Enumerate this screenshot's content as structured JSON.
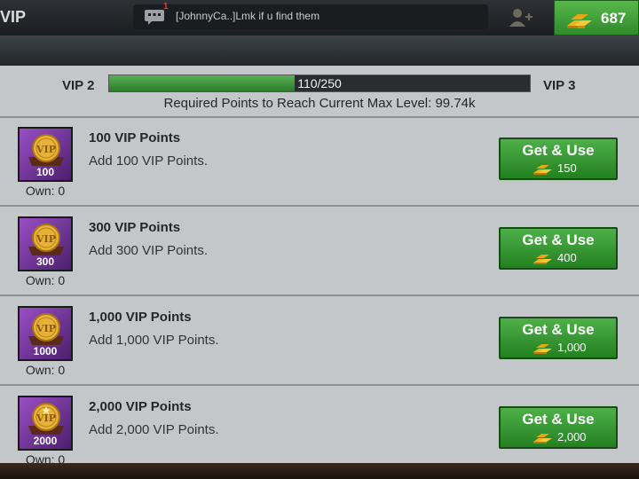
{
  "header": {
    "title": "VIP",
    "chat_badge": "1",
    "chat_message": "[JohnnyCa..]Lmk if u find them",
    "gold": "687"
  },
  "progress": {
    "current_level": "VIP 2",
    "next_level": "VIP 3",
    "text": "110/250",
    "fraction": 0.44,
    "requirement": "Required Points to Reach Current Max Level: 99.74k"
  },
  "items": [
    {
      "icon_number": "100",
      "own": "Own: 0",
      "name": "100 VIP Points",
      "desc": "Add 100 VIP Points.",
      "button_label": "Get & Use",
      "cost": "150"
    },
    {
      "icon_number": "300",
      "own": "Own: 0",
      "name": "300 VIP Points",
      "desc": "Add 300 VIP Points.",
      "button_label": "Get & Use",
      "cost": "400"
    },
    {
      "icon_number": "1000",
      "own": "Own: 0",
      "name": "1,000 VIP Points",
      "desc": "Add 1,000 VIP Points.",
      "button_label": "Get & Use",
      "cost": "1,000"
    },
    {
      "icon_number": "2000",
      "own": "Own: 0",
      "name": "2,000 VIP Points",
      "desc": "Add 2,000 VIP Points.",
      "button_label": "Get & Use",
      "cost": "2,000"
    }
  ],
  "colors": {
    "button_green": "#2f8a2b",
    "progress_green": "#4a9e45",
    "panel_gray": "#c4c7c9",
    "icon_purple": "#7a3aa3"
  }
}
